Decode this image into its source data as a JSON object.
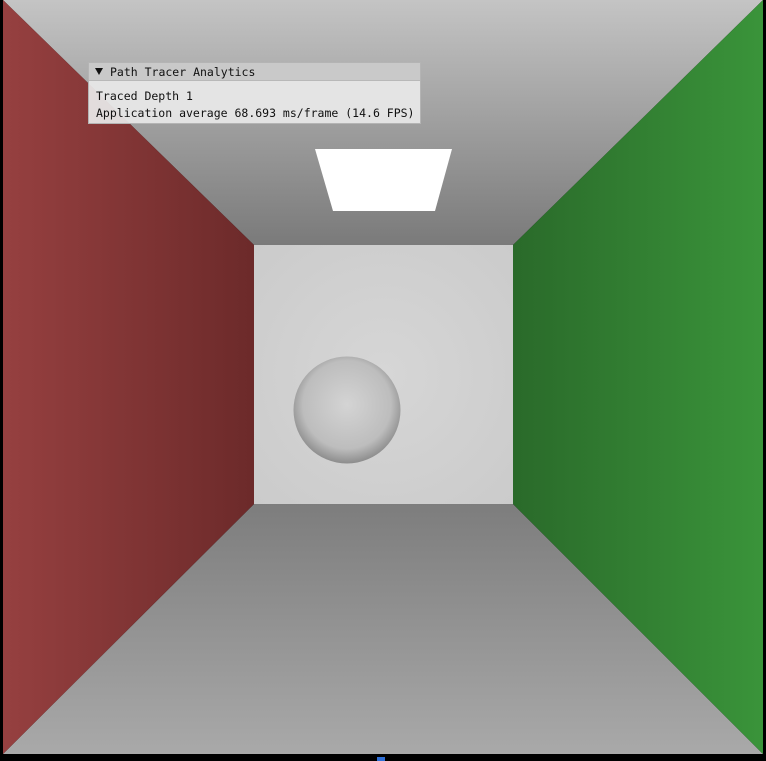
{
  "analytics_window": {
    "title": "Path Tracer Analytics",
    "collapse_icon": "triangle-down-icon",
    "traced_depth_text": "Traced Depth 1",
    "application_average_text": "Application average 68.693 ms/frame (14.6 FPS)"
  },
  "scene": {
    "left_wall_color": "#8a3535",
    "right_wall_color": "#338a33",
    "ceiling_color": "#bdbdbd",
    "floor_color": "#a0a0a0",
    "back_wall_color": "#d2d2d2",
    "light_color": "#ffffff",
    "sphere_color": "#c4c4c4"
  }
}
